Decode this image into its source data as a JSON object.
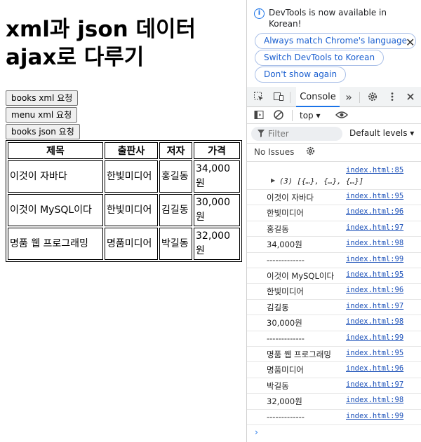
{
  "page": {
    "title": "xml과 json 데이터 ajax로 다루기",
    "buttons": {
      "books_xml": "books xml 요청",
      "menu_xml": "menu xml 요청",
      "books_json": "books json 요청"
    },
    "table": {
      "headers": [
        "제목",
        "출판사",
        "저자",
        "가격"
      ],
      "rows": [
        [
          "이것이 자바다",
          "한빛미디어",
          "홍길동",
          "34,000원"
        ],
        [
          "이것이 MySQL이다",
          "한빛미디어",
          "김길동",
          "30,000원"
        ],
        [
          "명품 웹 프로그래밍",
          "명품미디어",
          "박길동",
          "32,000원"
        ]
      ]
    }
  },
  "devtools": {
    "infobar": {
      "icon": "info-icon",
      "message": "DevTools is now available in Korean!",
      "buttons": [
        "Always match Chrome's language",
        "Switch DevTools to Korean",
        "Don't show again"
      ],
      "close": "✕"
    },
    "tabs": {
      "active": "Console",
      "more": "»"
    },
    "toolbar": {
      "context": "top ▾"
    },
    "filter": {
      "placeholder": "Filter",
      "levels": "Default levels ▾"
    },
    "issues": {
      "label": "No Issues"
    },
    "console": {
      "array": {
        "preview": "(3) [{…}, {…}, {…}]",
        "source": "index.html:85"
      },
      "logs": [
        {
          "msg": "이것이 자바다",
          "src": "index.html:95"
        },
        {
          "msg": "한빛미디어",
          "src": "index.html:96"
        },
        {
          "msg": "홍길동",
          "src": "index.html:97"
        },
        {
          "msg": "34,000원",
          "src": "index.html:98"
        },
        {
          "msg": "-------------",
          "src": "index.html:99"
        },
        {
          "msg": "이것이 MySQL이다",
          "src": "index.html:95"
        },
        {
          "msg": "한빛미디어",
          "src": "index.html:96"
        },
        {
          "msg": "김길동",
          "src": "index.html:97"
        },
        {
          "msg": "30,000원",
          "src": "index.html:98"
        },
        {
          "msg": "-------------",
          "src": "index.html:99"
        },
        {
          "msg": "명품 웹 프로그래밍",
          "src": "index.html:95"
        },
        {
          "msg": "명품미디어",
          "src": "index.html:96"
        },
        {
          "msg": "박길동",
          "src": "index.html:97"
        },
        {
          "msg": "32,000원",
          "src": "index.html:98"
        },
        {
          "msg": "-------------",
          "src": "index.html:99"
        }
      ],
      "prompt": "›"
    }
  }
}
